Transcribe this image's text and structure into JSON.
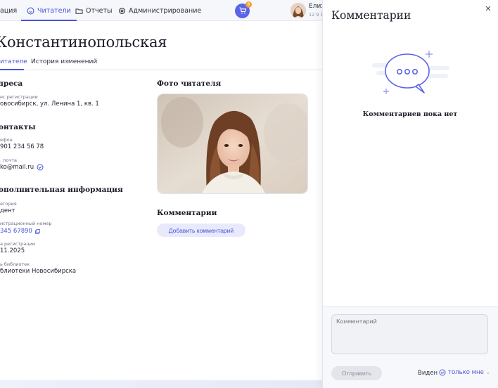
{
  "nav": {
    "items": [
      {
        "label": "ация",
        "icon": "none"
      },
      {
        "label": "Читатели",
        "icon": "smile-icon",
        "active": true
      },
      {
        "label": "Отчеты",
        "icon": "folder-icon"
      },
      {
        "label": "Администрирование",
        "icon": "gear-icon"
      }
    ],
    "cart_badge": "8",
    "user_name": "Елиз",
    "user_sub": "12 9 12"
  },
  "page": {
    "title": "Константинопольская",
    "tabs": [
      {
        "label": "итателе",
        "active": true
      },
      {
        "label": "История изменений",
        "active": false
      }
    ]
  },
  "sections": {
    "address": {
      "heading": "дреса",
      "reg_label": "ес регистрации",
      "reg_value": "овосибирск, ул. Ленина 1, кв. 1"
    },
    "contacts": {
      "heading": "онтакты",
      "phone_label": "ефон",
      "phone_value": "901 234 56 78",
      "email_label": ". почта",
      "email_value": "ko@mail.ru"
    },
    "extra": {
      "heading": "ополнительная информация",
      "category_label": "егория",
      "category_value": "дент",
      "regnum_label": "истрационный номер",
      "regnum_value": "345 67890",
      "regdate_label": "а регистрации",
      "regdate_value": "11.2025",
      "library_label": "ь библиотек",
      "library_value": "блиотеки Новосибирска"
    }
  },
  "photo": {
    "heading": "Фото читателя"
  },
  "comments": {
    "heading": "Комментарии",
    "add_button": "Добавить комментарий"
  },
  "drawer": {
    "title": "Комментарии",
    "empty_text": "Комментариев пока нет",
    "input_placeholder": "Комментарий",
    "send_button": "Отправить",
    "visibility_label": "Виден",
    "visibility_value": "только мне"
  },
  "colors": {
    "accent": "#4a55d6",
    "cart": "#5b63e8",
    "badge": "#f39c2b"
  }
}
